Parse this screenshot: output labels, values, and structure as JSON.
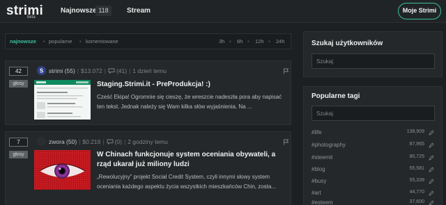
{
  "header": {
    "logo": "strimi",
    "logo_sub": "beta",
    "nav_newest": "Najnowsze",
    "nav_newest_count": "118",
    "nav_stream": "Stream",
    "my_strimi": "Moje Strimi"
  },
  "filters": {
    "sort": [
      "najnowsze",
      "popularne",
      "komentowane"
    ],
    "time": [
      "3h",
      "6h",
      "12h",
      "24h"
    ]
  },
  "posts": [
    {
      "votes": "42",
      "vote_label": "głosy",
      "author": "strimi (55)",
      "value": "$13.072",
      "comments": "(41)",
      "time": "1 dzień temu",
      "title": "Staging.Strimi.it - PreProdukcja! :)",
      "excerpt": "Cześć Ekipa! Ogromnie się cieszę, że wreszcie nadeszła pora aby napisać ten tekst. Jednak należy się Wam kilka słów wyjaśnienia. Na ..."
    },
    {
      "votes": "7",
      "vote_label": "głosy",
      "author": "zwora (50)",
      "value": "$0.219",
      "comments": "(0)",
      "time": "2 godziny temu",
      "title": "W Chinach funkcjonuje system oceniania obywateli, a rząd ukarał już miliony ludzi",
      "excerpt": "„Rewolucyjny” projekt Social Credit System, czyli innymi słowy system oceniania każdego aspektu życia wszystkich mieszkańców Chin, zosta..."
    }
  ],
  "sidebar": {
    "search_users": {
      "heading": "Szukaj użytkowników",
      "placeholder": "Szukaj"
    },
    "popular_tags": {
      "heading": "Popularne tagi",
      "placeholder": "Szukaj",
      "tags": [
        {
          "name": "#life",
          "count": "138,909"
        },
        {
          "name": "#photography",
          "count": "87,965"
        },
        {
          "name": "#steemit",
          "count": "80,725"
        },
        {
          "name": "#blog",
          "count": "55,581"
        },
        {
          "name": "#busy",
          "count": "55,339"
        },
        {
          "name": "#art",
          "count": "44,770"
        },
        {
          "name": "#esteem",
          "count": "37,600"
        }
      ]
    }
  },
  "colors": {
    "accent": "#3bc1a0",
    "background": "#1d2022",
    "card": "#24282a"
  },
  "icons": [
    "comment-icon",
    "flag-icon",
    "edit-icon"
  ]
}
